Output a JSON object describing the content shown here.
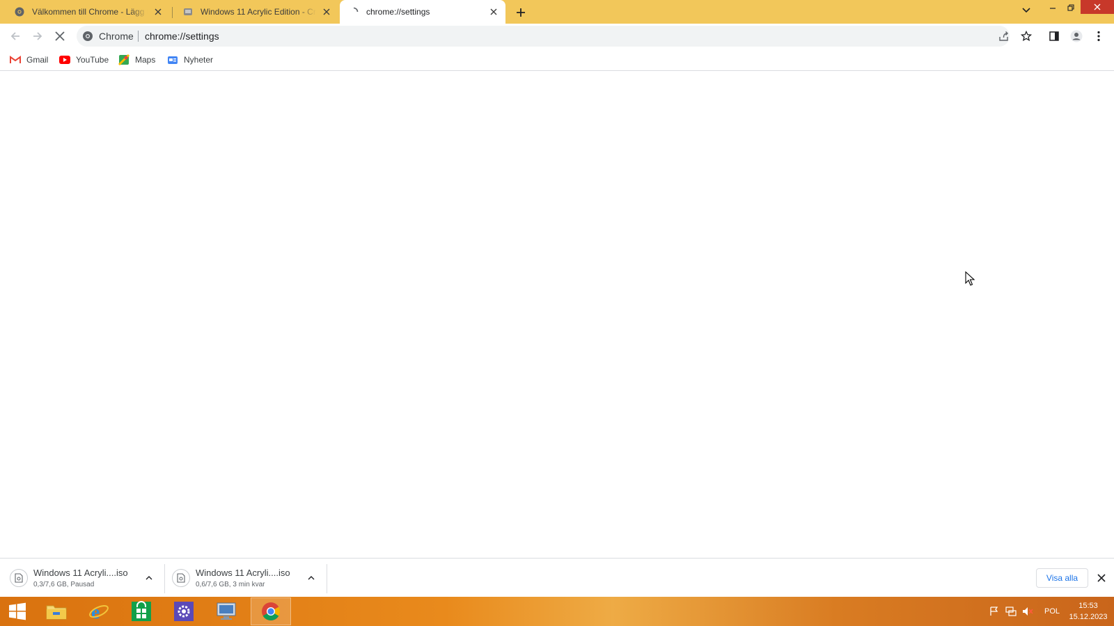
{
  "browser": {
    "tabs": [
      {
        "title": "Välkommen till Chrome - Lägg till",
        "icon": "chrome-icon",
        "active": false
      },
      {
        "title": "Windows 11 Acrylic Edition - Cru",
        "icon": "site-favicon",
        "active": false
      },
      {
        "title": "chrome://settings",
        "icon": "loading-spinner-icon",
        "active": true
      }
    ],
    "omnibox": {
      "chip": "Chrome",
      "url": "chrome://settings"
    },
    "bookmarks": [
      {
        "label": "Gmail",
        "icon": "gmail-icon"
      },
      {
        "label": "YouTube",
        "icon": "youtube-icon"
      },
      {
        "label": "Maps",
        "icon": "maps-icon"
      },
      {
        "label": "Nyheter",
        "icon": "news-icon"
      }
    ]
  },
  "downloads": {
    "items": [
      {
        "name": "Windows 11 Acryli....iso",
        "status": "0,3/7,6 GB, Pausad"
      },
      {
        "name": "Windows 11 Acryli....iso",
        "status": "0,6/7,6 GB, 3 min kvar"
      }
    ],
    "show_all": "Visa alla"
  },
  "taskbar": {
    "apps": [
      "start-icon",
      "file-explorer-icon",
      "internet-explorer-icon",
      "store-icon",
      "settings-icon",
      "remote-desktop-icon",
      "chrome-icon"
    ],
    "language": "POL",
    "time": "15:53",
    "date": "15.12.2023"
  },
  "colors": {
    "tabstrip": "#f2c75a",
    "accent_link": "#1a73e8",
    "taskbar": "#e98a1c"
  }
}
